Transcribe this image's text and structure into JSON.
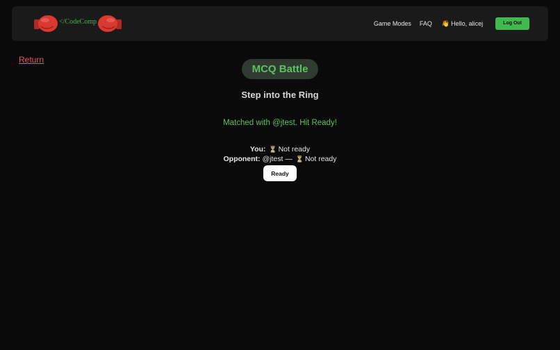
{
  "navbar": {
    "logo_text": "</CodeComp",
    "links": [
      "Game Modes",
      "FAQ"
    ],
    "greeting": "Hello, alicej",
    "logout_label": "Log Out"
  },
  "return_label": "Return",
  "mode_title": "MCQ Battle",
  "subtitle": "Step into the Ring",
  "match_message": "Matched with @jtest. Hit Ready!",
  "status": {
    "you_label": "You:",
    "you_state": "Not ready",
    "opponent_label": "Opponent:",
    "opponent_name": "@jtest —",
    "opponent_state": "Not ready"
  },
  "ready_label": "Ready",
  "colors": {
    "accent_green": "#5cc160",
    "logout_green": "#3fb950",
    "return_red": "#e05a5a",
    "glove_red": "#d9392e"
  }
}
